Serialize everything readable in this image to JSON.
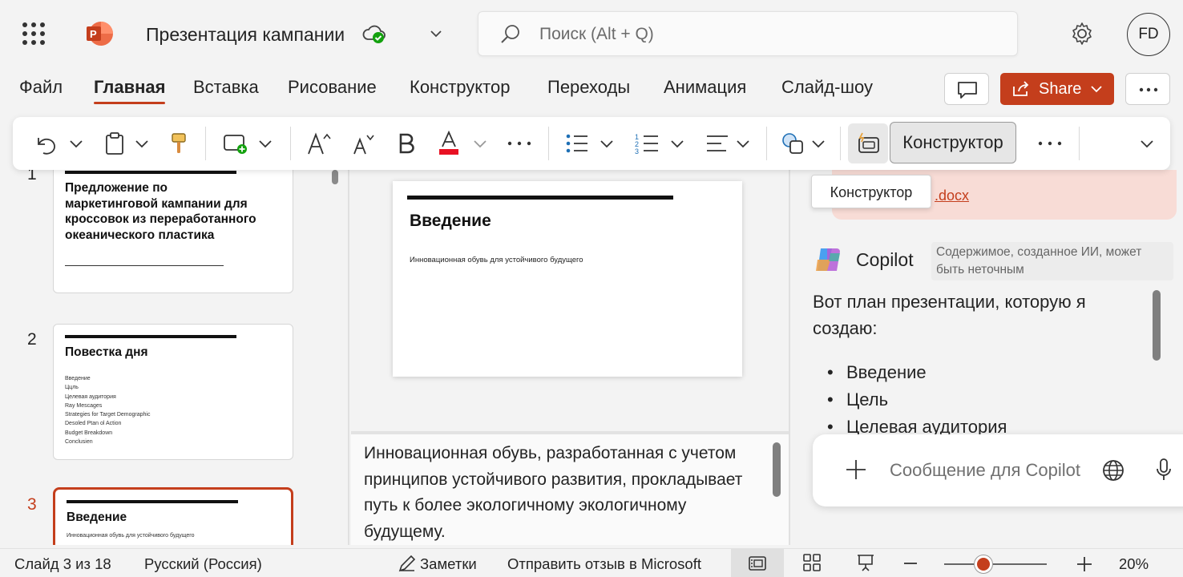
{
  "app": {
    "title": "Презентация кампании",
    "search_placeholder": "Поиск (Alt + Q)",
    "user_initials": "FD",
    "accent_color": "#c43e1c"
  },
  "menu": {
    "items": [
      "Файл",
      "Главная",
      "Вставка",
      "Рисование",
      "Конструктор",
      "Переходы",
      "Анимация",
      "Слайд-шоу"
    ],
    "active": "Главная",
    "share_label": "Share"
  },
  "ribbon": {
    "designer_label": "Конструктор",
    "tooltip": "Конструктор",
    "icons": [
      "undo-icon",
      "clipboard-icon",
      "format-painter-icon",
      "new-slide-icon",
      "font-grow-icon",
      "font-shrink-icon",
      "bold-icon",
      "font-color-icon",
      "more-icon",
      "bullets-icon",
      "numbering-icon",
      "align-icon",
      "shapes-icon",
      "designer-icon"
    ]
  },
  "thumbnails": [
    {
      "number": "1",
      "title": "Предложение по маркетинговой кампании для кроссовок из переработанного океанического пластика",
      "lines": []
    },
    {
      "number": "2",
      "title": "Повестка дня",
      "lines": [
        "Введение",
        "Ццль",
        "Целевая аудитория",
        "Ray Mescages",
        "Strategies for Target Demographic",
        "Desoled Ptan ol Action",
        "Budget Breakdown",
        "Conclusien"
      ]
    },
    {
      "number": "3",
      "title": "Введение",
      "lines": [
        "Инновационная обувь для устойчивого будущего"
      ]
    }
  ],
  "slide": {
    "title": "Введение",
    "subtitle": "Инновационная обувь для устойчивого будущего"
  },
  "notes": {
    "text": "Инновационная обувь, разработанная с учетом принципов устойчивого развития, прокладывает путь к более экологичному экологичному будущему."
  },
  "copilot": {
    "file_link": ".docx",
    "name": "Copilot",
    "ai_disclaimer": "Содержимое, созданное ИИ, может быть неточным",
    "message": "Вот план презентации, которую я создаю:",
    "list": [
      "Введение",
      "Цель",
      "Целевая аудитория"
    ],
    "input_placeholder": "Сообщение для Copilot"
  },
  "status": {
    "slide_info": "Слайд 3 из 18",
    "language": "Русский (Россия)",
    "notes_label": "Заметки",
    "feedback": "Отправить отзыв в Microsoft",
    "zoom": "20%",
    "zoom_fraction": 0.38
  }
}
